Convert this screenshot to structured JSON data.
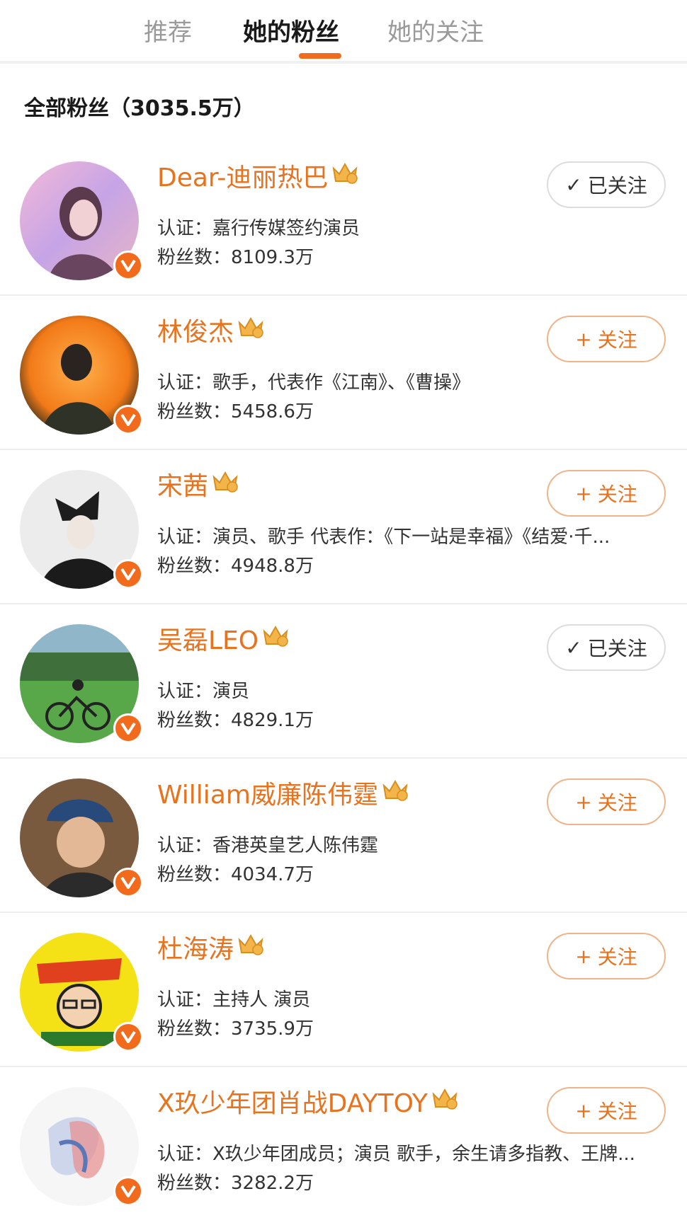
{
  "tabs": [
    {
      "label": "推荐",
      "active": false
    },
    {
      "label": "她的粉丝",
      "active": true
    },
    {
      "label": "她的关注",
      "active": false
    }
  ],
  "section_title": "全部粉丝（3035.5万）",
  "colors": {
    "accent": "#f06b1d",
    "name": "#e8731f",
    "verified": "#f26b1d"
  },
  "fans": [
    {
      "name": "Dear-迪丽热巴",
      "crown_level": "9",
      "cert": "认证：嘉行传媒签约演员",
      "fans_count": "粉丝数：8109.3万",
      "button": "已关注",
      "button_icon": "checkmark-icon",
      "following": true
    },
    {
      "name": "林俊杰",
      "crown_level": "10",
      "cert": "认证：歌手，代表作《江南》、《曹操》",
      "fans_count": "粉丝数：5458.6万",
      "button": "关注",
      "button_icon": "plus-icon",
      "following": false
    },
    {
      "name": "宋茜",
      "crown_level": "8",
      "cert": "认证：演员、歌手 代表作：《下一站是幸福》《结爱·千...",
      "fans_count": "粉丝数：4948.8万",
      "button": "关注",
      "button_icon": "plus-icon",
      "following": false
    },
    {
      "name": "吴磊LEO",
      "crown_level": "8",
      "cert": "认证：演员",
      "fans_count": "粉丝数：4829.1万",
      "button": "已关注",
      "button_icon": "checkmark-icon",
      "following": true
    },
    {
      "name": "William威廉陈伟霆",
      "crown_level": "",
      "cert": "认证：香港英皇艺人陈伟霆",
      "fans_count": "粉丝数：4034.7万",
      "button": "关注",
      "button_icon": "plus-icon",
      "following": false
    },
    {
      "name": "杜海涛",
      "crown_level": "8",
      "cert": "认证：主持人 演员",
      "fans_count": "粉丝数：3735.9万",
      "button": "关注",
      "button_icon": "plus-icon",
      "following": false
    },
    {
      "name": "X玖少年团肖战DAYTOY",
      "crown_level": "8",
      "cert": "认证：X玖少年团成员；演员 歌手，余生请多指教、王牌...",
      "fans_count": "粉丝数：3282.2万",
      "button": "关注",
      "button_icon": "plus-icon",
      "following": false
    }
  ]
}
